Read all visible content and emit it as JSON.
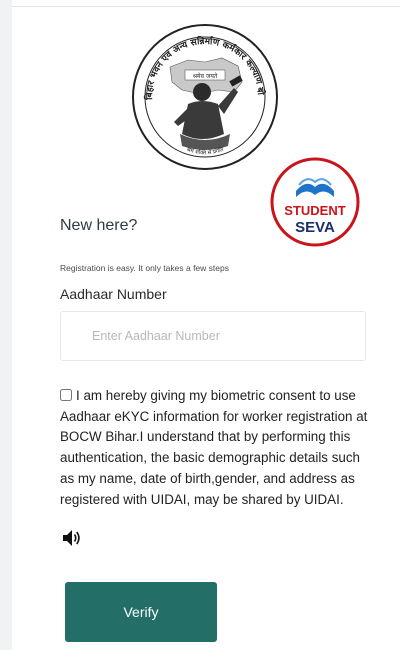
{
  "emblem": {
    "top_text": "बिहार भवन एवं अन्य सन्निर्माण कर्मकार कल्याण बोर्ड",
    "banner_text": "श्रमेव जयते",
    "bottom_text": "श्रम शक्ति से प्रगति"
  },
  "watermark": {
    "line1": "STUDENT",
    "line2": "SEVA",
    "colors": {
      "red": "#c9141b",
      "navy": "#1a2f6b",
      "blue": "#1e74c8"
    }
  },
  "heading": "New here?",
  "subtext": "Registration is easy. It only takes a few steps",
  "aadhaar": {
    "label": "Aadhaar Number",
    "placeholder": "Enter Aadhaar Number",
    "value": ""
  },
  "consent": {
    "checked": false,
    "text": "I am hereby giving my biometric consent to use Aadhaar eKYC information for worker registration at BOCW Bihar.I understand that by performing this authentication, the basic demographic details such as my name, date of birth,gender, and address as registered with UIDAI, may be shared by UIDAI."
  },
  "speaker_icon": "speaker-icon",
  "verify_button": {
    "label": "Verify",
    "color": "#236f68"
  }
}
